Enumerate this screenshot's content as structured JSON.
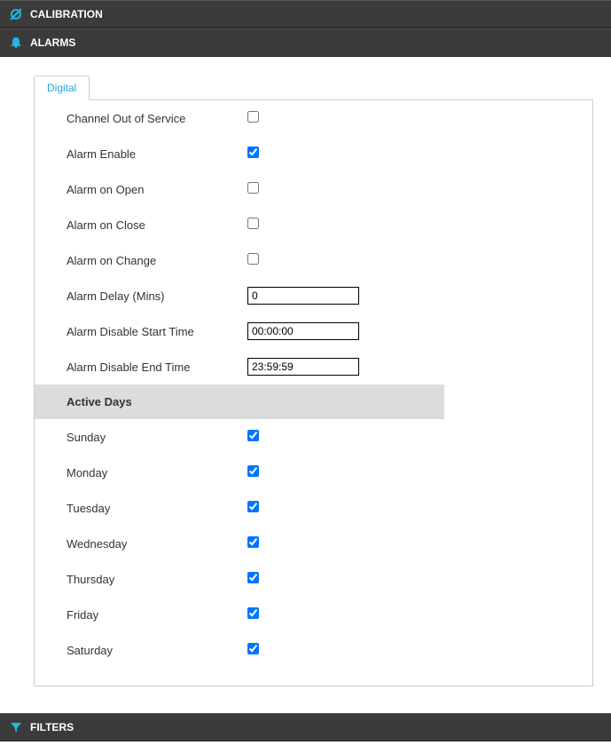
{
  "sections": {
    "calibration": {
      "title": "CALIBRATION"
    },
    "alarms": {
      "title": "ALARMS"
    },
    "filters": {
      "title": "FILTERS"
    }
  },
  "alarms": {
    "tab_label": "Digital",
    "fields": {
      "channel_out_of_service": {
        "label": "Channel Out of Service",
        "checked": false
      },
      "alarm_enable": {
        "label": "Alarm Enable",
        "checked": true
      },
      "alarm_on_open": {
        "label": "Alarm on Open",
        "checked": false
      },
      "alarm_on_close": {
        "label": "Alarm on Close",
        "checked": false
      },
      "alarm_on_change": {
        "label": "Alarm on Change",
        "checked": false
      },
      "alarm_delay": {
        "label": "Alarm Delay (Mins)",
        "value": "0"
      },
      "alarm_disable_start": {
        "label": "Alarm Disable Start Time",
        "value": "00:00:00"
      },
      "alarm_disable_end": {
        "label": "Alarm Disable End Time",
        "value": "23:59:59"
      }
    },
    "active_days_header": "Active Days",
    "active_days": {
      "sunday": {
        "label": "Sunday",
        "checked": true
      },
      "monday": {
        "label": "Monday",
        "checked": true
      },
      "tuesday": {
        "label": "Tuesday",
        "checked": true
      },
      "wednesday": {
        "label": "Wednesday",
        "checked": true
      },
      "thursday": {
        "label": "Thursday",
        "checked": true
      },
      "friday": {
        "label": "Friday",
        "checked": true
      },
      "saturday": {
        "label": "Saturday",
        "checked": true
      }
    }
  }
}
